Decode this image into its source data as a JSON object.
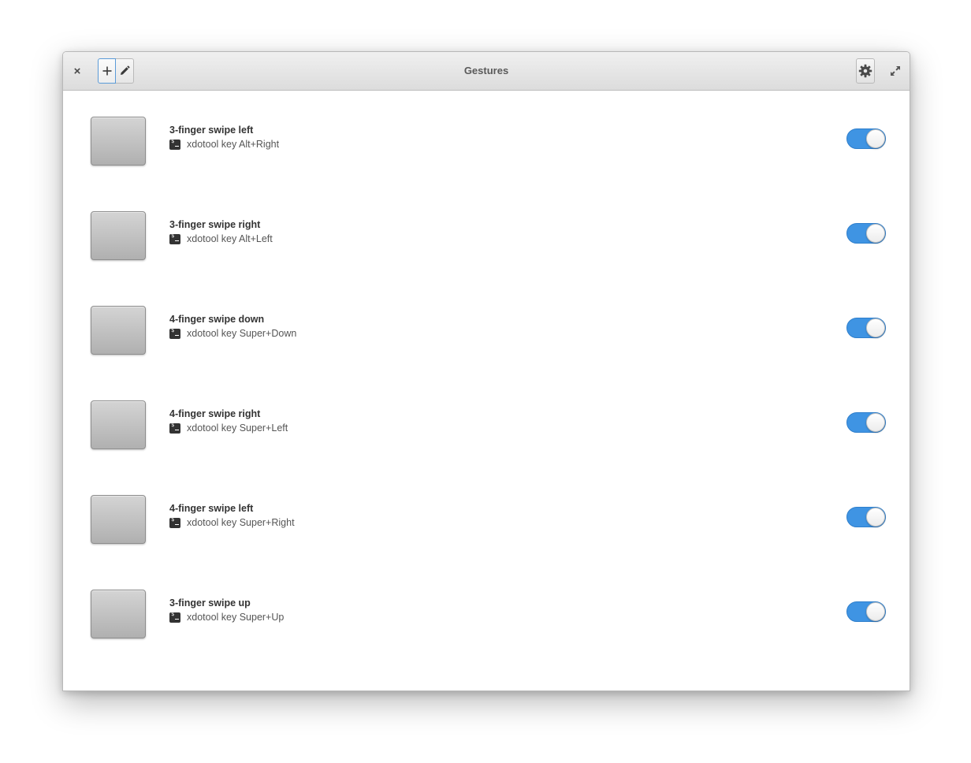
{
  "window": {
    "title": "Gestures"
  },
  "titlebar": {
    "close_label": "×",
    "add_icon": "plus-icon",
    "edit_icon": "pencil-icon",
    "settings_icon": "gear-icon",
    "maximize_icon": "maximize-icon"
  },
  "gestures": [
    {
      "title": "3-finger swipe left",
      "command": "xdotool key Alt+Right",
      "enabled": true
    },
    {
      "title": "3-finger swipe right",
      "command": "xdotool key Alt+Left",
      "enabled": true
    },
    {
      "title": "4-finger swipe down",
      "command": "xdotool key Super+Down",
      "enabled": true
    },
    {
      "title": "4-finger swipe right",
      "command": "xdotool key Super+Left",
      "enabled": true
    },
    {
      "title": "4-finger swipe left",
      "command": "xdotool key Super+Right",
      "enabled": true
    },
    {
      "title": "3-finger swipe up",
      "command": "xdotool key Super+Up",
      "enabled": true
    }
  ],
  "colors": {
    "toggle_on": "#3f94e3",
    "accent_border": "#5b9bd8"
  }
}
